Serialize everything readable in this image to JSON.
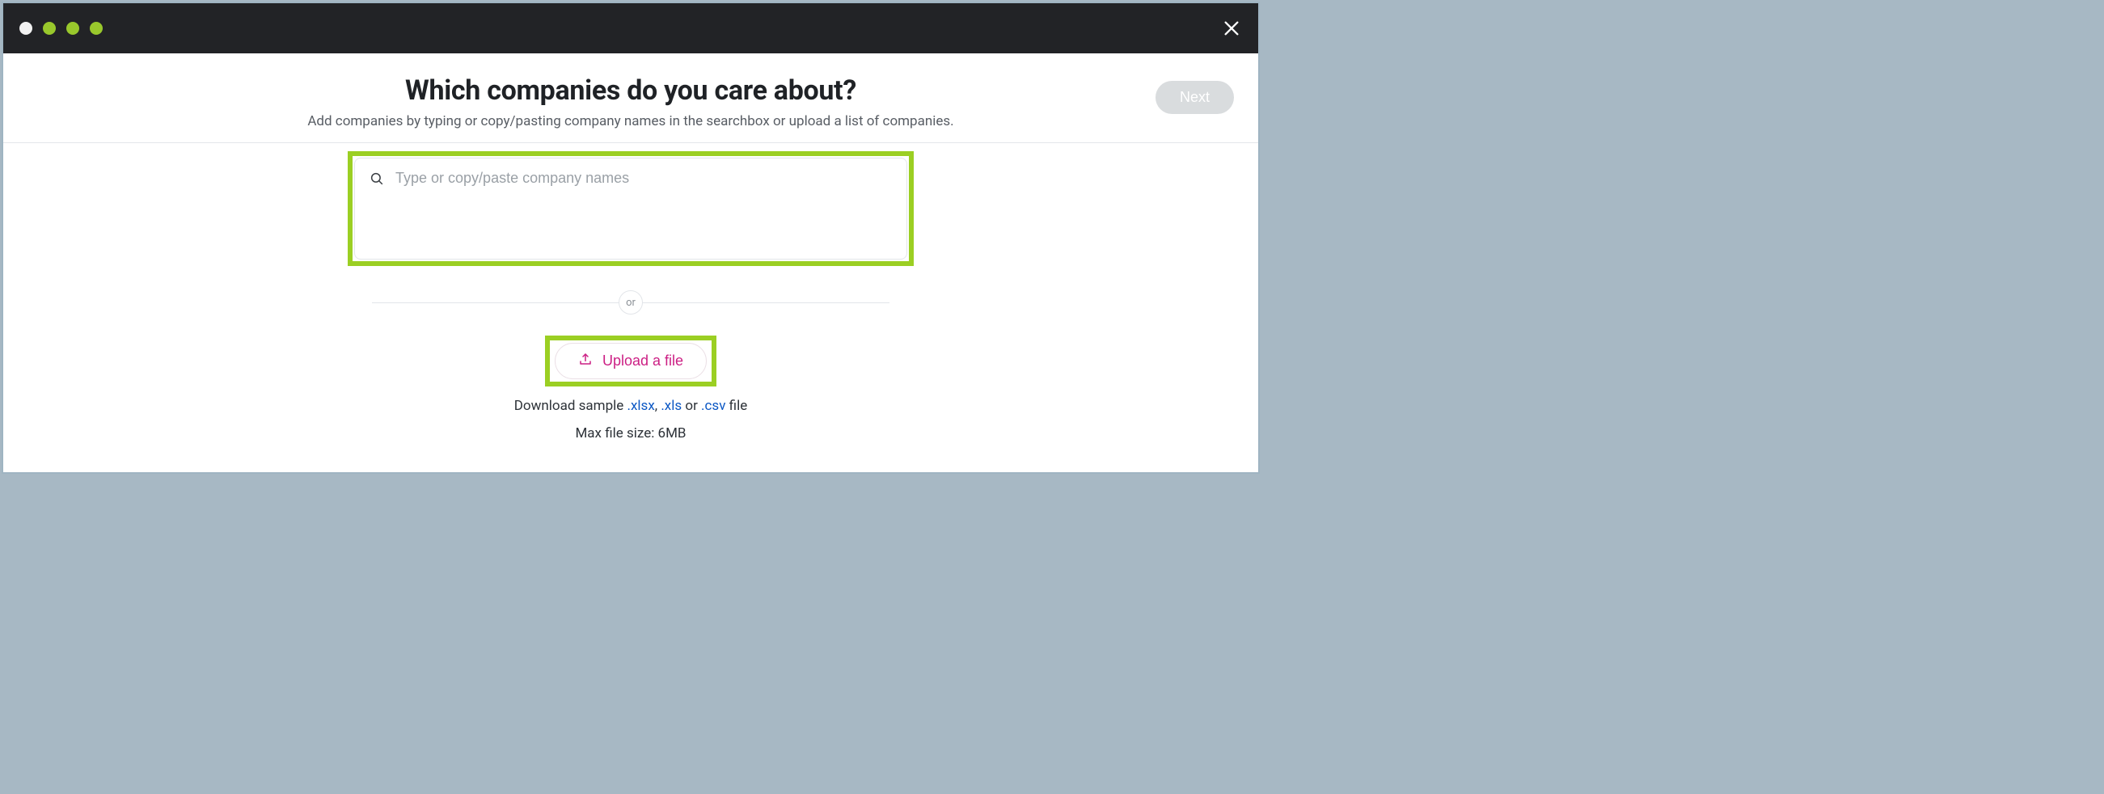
{
  "header": {
    "title": "Which companies do you care about?",
    "subtitle": "Add companies by typing or copy/pasting company names in the searchbox or upload a list of companies.",
    "next_label": "Next"
  },
  "search": {
    "placeholder": "Type or copy/paste company names",
    "value": ""
  },
  "divider": {
    "or_label": "or"
  },
  "upload": {
    "button_label": "Upload a file",
    "sample_prefix": "Download sample ",
    "xlsx": ".xlsx",
    "sep1": ", ",
    "xls": ".xls",
    "sep2": " or ",
    "csv": ".csv",
    "sample_suffix": " file",
    "max_size": "Max file size: 6MB"
  }
}
